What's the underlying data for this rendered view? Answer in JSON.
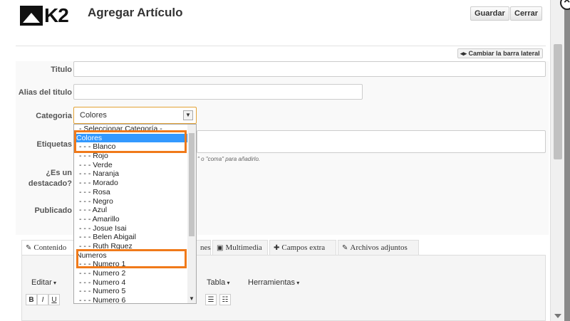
{
  "header": {
    "title": "Agregar Artículo",
    "logo_text": "K2",
    "save_label": "Guardar",
    "close_label": "Cerrar"
  },
  "sidebar_toggle": "Cambiar la barra lateral",
  "form": {
    "title_label": "Titulo",
    "alias_label": "Alias del titulo",
    "category_label": "Categoria",
    "category_value": "Colores",
    "tags_label": "Etiquetas",
    "featured_label_1": "¿Es un",
    "featured_label_2": "destacado?",
    "published_label": "Publicado",
    "tags_hint": "\" o \"coma\" para añadirlo."
  },
  "dropdown": {
    "items": [
      "- Seleccionar Categoría -",
      "Colores",
      "- - - Blanco",
      "- - - Rojo",
      "- - - Verde",
      "- - - Naranja",
      "- - - Morado",
      "- - - Rosa",
      "- - - Negro",
      "- - - Azul",
      "- - - Amarillo",
      "- - - Josue Isai",
      "- - - Belen Abigail",
      "- - - Ruth Rguez",
      "Numeros",
      "- - - Numero 1",
      "- - - Numero 2",
      "- - - Numero 4",
      "- - - Numero 5",
      "- - - Numero 6"
    ],
    "selected_index": 1
  },
  "tabs": [
    {
      "label": "Contenido",
      "icon": "edit-icon"
    },
    {
      "label": "nes",
      "icon": "image-icon"
    },
    {
      "label": "Multimedia",
      "icon": "film-icon"
    },
    {
      "label": "Campos extra",
      "icon": "tag-icon"
    },
    {
      "label": "Archivos adjuntos",
      "icon": "paperclip-icon"
    }
  ],
  "editor": {
    "menus": [
      "Editar",
      "Tabla",
      "Herramientas"
    ],
    "tools": [
      "B",
      "I",
      "U"
    ]
  },
  "colors": {
    "highlight": "#f07a1a",
    "selected": "#3399ff"
  }
}
